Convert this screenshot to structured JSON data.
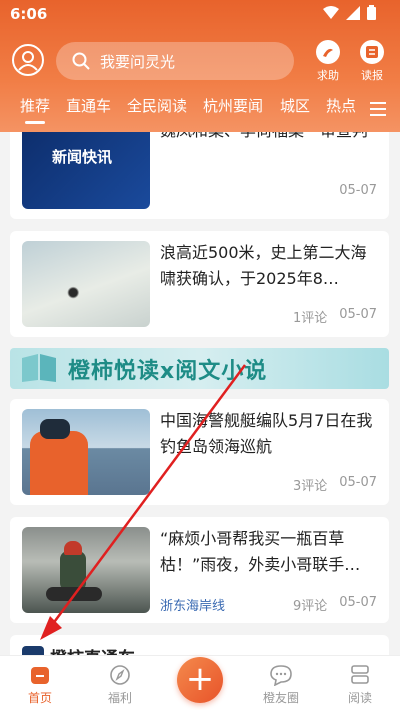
{
  "status_bar": {
    "time": "6:06"
  },
  "header": {
    "search_placeholder": "我要问灵光",
    "actions": [
      {
        "label": "求助",
        "icon": "help-badge-icon"
      },
      {
        "label": "读报",
        "icon": "newspaper-icon"
      }
    ]
  },
  "tabs": [
    "推荐",
    "直通车",
    "全民阅读",
    "杭州要闻",
    "城区",
    "热点"
  ],
  "active_tab": "推荐",
  "articles": [
    {
      "title": "魏凤和案、李尚福案一审宣判",
      "thumb_text": "新闻快讯",
      "date": "05-07",
      "comments": ""
    },
    {
      "title": "浪高近500米，史上第二大海啸获确认，于2025年8…",
      "date": "05-07",
      "comments": "1评论"
    },
    {
      "title": "中国海警舰艇编队5月7日在我钓鱼岛领海巡航",
      "date": "05-07",
      "comments": "3评论"
    },
    {
      "title": "“麻烦小哥帮我买一瓶百草枯！”雨夜，外卖小哥联手…",
      "source": "浙东海岸线",
      "date": "05-07",
      "comments": "9评论"
    }
  ],
  "banner": {
    "text": "橙柿悦读x阅文小说"
  },
  "partial_card_title": "橙柿直通车",
  "bottom_nav": [
    {
      "label": "首页",
      "icon": "home-icon"
    },
    {
      "label": "福利",
      "icon": "compass-icon"
    },
    {
      "label": "",
      "icon": "plus-icon"
    },
    {
      "label": "橙友圈",
      "icon": "chat-icon"
    },
    {
      "label": "阅读",
      "icon": "reading-icon"
    }
  ],
  "colors": {
    "brand": "#e8632c",
    "link": "#3a6ab2",
    "meta": "#999999"
  }
}
